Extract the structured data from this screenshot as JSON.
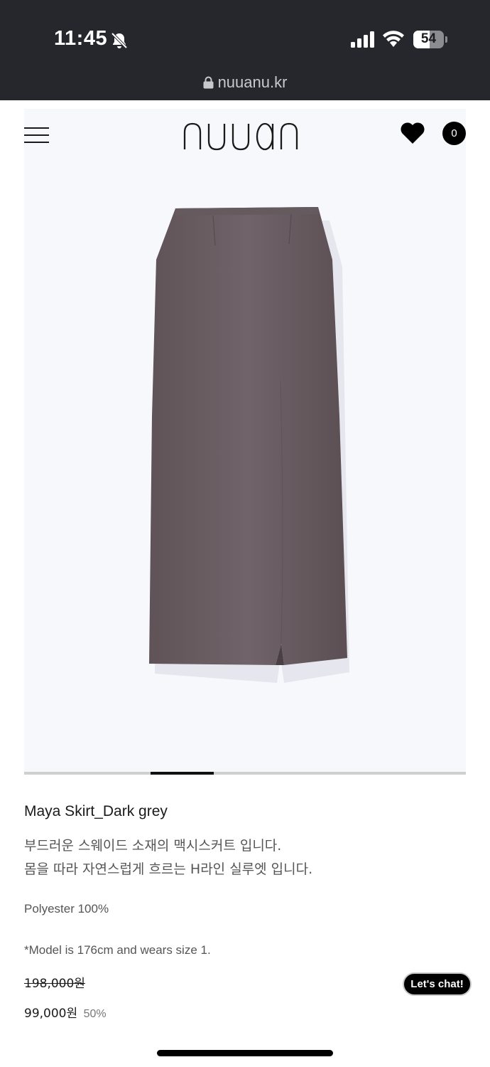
{
  "status_bar": {
    "time": "11:45",
    "battery_level": "54",
    "battery_fraction": 0.54,
    "icons": [
      "bell-slash-icon",
      "cellular-signal-icon",
      "wifi-icon",
      "battery-icon"
    ]
  },
  "browser": {
    "url": "nuuanu.kr"
  },
  "header": {
    "logo_text": "nuuanu",
    "cart_count": "0",
    "icons": [
      "hamburger-menu-icon",
      "heart-icon"
    ]
  },
  "product": {
    "image_alt": "Maya Skirt in dark grey suede, maxi length with back slit",
    "carousel": {
      "current_index": 2,
      "total": 7
    },
    "title": "Maya Skirt_Dark grey",
    "description_line1": "부드러운 스웨이드 소재의 맥시스커트 입니다.",
    "description_line2": "몸을 따라 자연스럽게 흐르는 H라인 실루엣 입니다.",
    "material": "Polyester 100%",
    "model_note": "*Model is 176cm and wears size 1.",
    "original_price": "198,000원",
    "sale_price": "99,000원",
    "discount": "50%"
  },
  "chat_button": {
    "label": "Let's chat!"
  },
  "colors": {
    "status_bar_bg": "#25272c",
    "skirt": "#6b5f63",
    "hero_bg": "#f7f8fb"
  }
}
